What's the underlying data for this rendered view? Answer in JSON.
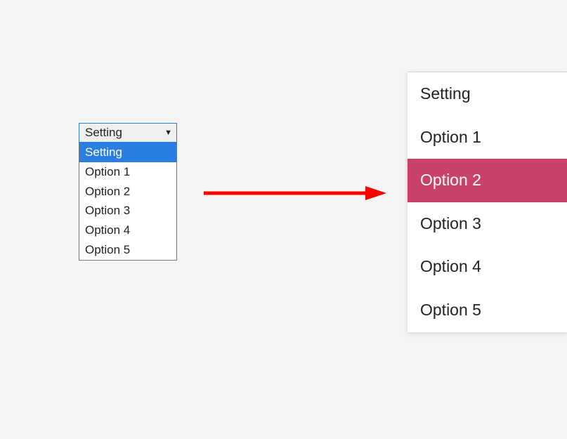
{
  "native_select": {
    "button_label": "Setting",
    "options": [
      {
        "label": "Setting",
        "highlighted": true
      },
      {
        "label": "Option 1",
        "highlighted": false
      },
      {
        "label": "Option 2",
        "highlighted": false
      },
      {
        "label": "Option 3",
        "highlighted": false
      },
      {
        "label": "Option 4",
        "highlighted": false
      },
      {
        "label": "Option 5",
        "highlighted": false
      }
    ]
  },
  "styled_select": {
    "options": [
      {
        "label": "Setting",
        "selected": false
      },
      {
        "label": "Option 1",
        "selected": false
      },
      {
        "label": "Option 2",
        "selected": true
      },
      {
        "label": "Option 3",
        "selected": false
      },
      {
        "label": "Option 4",
        "selected": false
      },
      {
        "label": "Option 5",
        "selected": false
      }
    ]
  },
  "colors": {
    "native_highlight": "#2a7de1",
    "styled_highlight": "#c9426c",
    "arrow": "#ff0000"
  }
}
